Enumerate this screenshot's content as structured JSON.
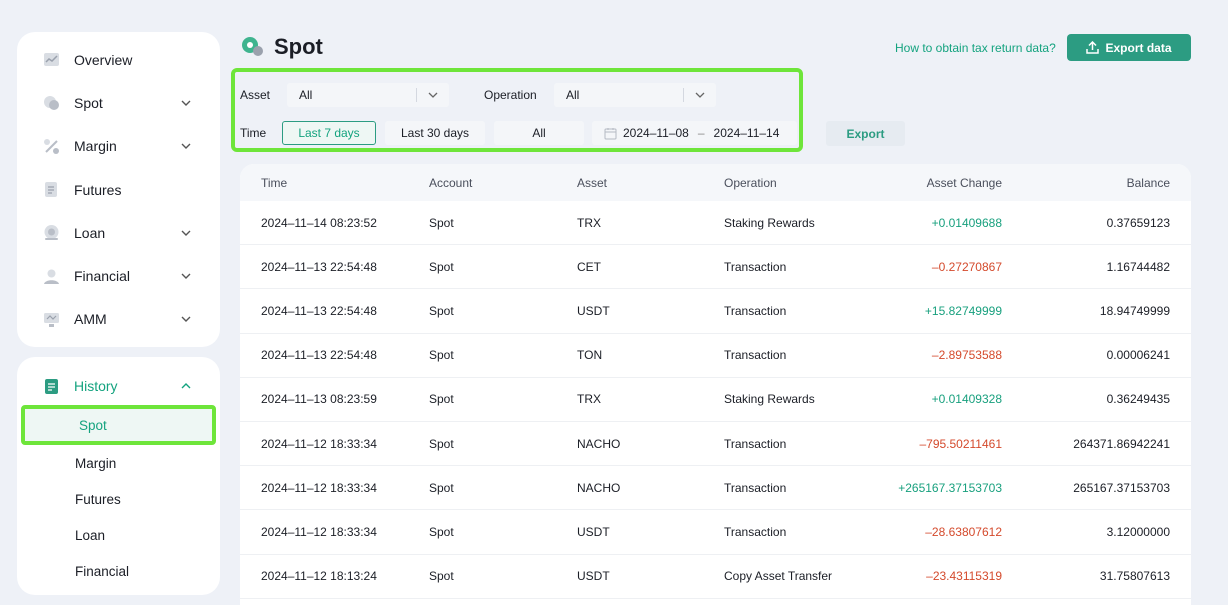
{
  "sidebar": {
    "items": [
      {
        "label": "Overview",
        "icon": "chart-icon",
        "has_chevron": false
      },
      {
        "label": "Spot",
        "icon": "coin-icon",
        "has_chevron": true
      },
      {
        "label": "Margin",
        "icon": "percent-icon",
        "has_chevron": true
      },
      {
        "label": "Futures",
        "icon": "document-icon",
        "has_chevron": false
      },
      {
        "label": "Loan",
        "icon": "loan-icon",
        "has_chevron": true
      },
      {
        "label": "Financial",
        "icon": "user-icon",
        "has_chevron": true
      },
      {
        "label": "AMM",
        "icon": "monitor-icon",
        "has_chevron": true
      }
    ],
    "history": {
      "label": "History",
      "sub_items": [
        "Spot",
        "Margin",
        "Futures",
        "Loan",
        "Financial"
      ],
      "active": "Spot"
    }
  },
  "header": {
    "title": "Spot",
    "tax_link": "How to obtain tax return data?",
    "export_data": "Export data"
  },
  "filters": {
    "asset_label": "Asset",
    "asset_value": "All",
    "operation_label": "Operation",
    "operation_value": "All",
    "time_label": "Time",
    "time_options": [
      "Last 7 days",
      "Last 30 days",
      "All"
    ],
    "time_active": "Last 7 days",
    "date_start": "2024–11–08",
    "date_sep": "–",
    "date_end": "2024–11–14",
    "export": "Export"
  },
  "table": {
    "columns": [
      "Time",
      "Account",
      "Asset",
      "Operation",
      "Asset Change",
      "Balance"
    ],
    "rows": [
      {
        "time": "2024–11–14 08:23:52",
        "account": "Spot",
        "asset": "TRX",
        "operation": "Staking Rewards",
        "change": "+0.01409688",
        "balance": "0.37659123"
      },
      {
        "time": "2024–11–13 22:54:48",
        "account": "Spot",
        "asset": "CET",
        "operation": "Transaction",
        "change": "–0.27270867",
        "balance": "1.16744482"
      },
      {
        "time": "2024–11–13 22:54:48",
        "account": "Spot",
        "asset": "USDT",
        "operation": "Transaction",
        "change": "+15.82749999",
        "balance": "18.94749999"
      },
      {
        "time": "2024–11–13 22:54:48",
        "account": "Spot",
        "asset": "TON",
        "operation": "Transaction",
        "change": "–2.89753588",
        "balance": "0.00006241"
      },
      {
        "time": "2024–11–13 08:23:59",
        "account": "Spot",
        "asset": "TRX",
        "operation": "Staking Rewards",
        "change": "+0.01409328",
        "balance": "0.36249435"
      },
      {
        "time": "2024–11–12 18:33:34",
        "account": "Spot",
        "asset": "NACHO",
        "operation": "Transaction",
        "change": "–795.50211461",
        "balance": "264371.86942241"
      },
      {
        "time": "2024–11–12 18:33:34",
        "account": "Spot",
        "asset": "NACHO",
        "operation": "Transaction",
        "change": "+265167.37153703",
        "balance": "265167.37153703"
      },
      {
        "time": "2024–11–12 18:33:34",
        "account": "Spot",
        "asset": "USDT",
        "operation": "Transaction",
        "change": "–28.63807612",
        "balance": "3.12000000"
      },
      {
        "time": "2024–11–12 18:13:24",
        "account": "Spot",
        "asset": "USDT",
        "operation": "Copy Asset Transfer",
        "change": "–23.43115319",
        "balance": "31.75807613"
      }
    ]
  },
  "colors": {
    "accent": "#14a37f",
    "positive": "#18a07e",
    "negative": "#d44a2c",
    "highlight": "#6ee53a"
  }
}
